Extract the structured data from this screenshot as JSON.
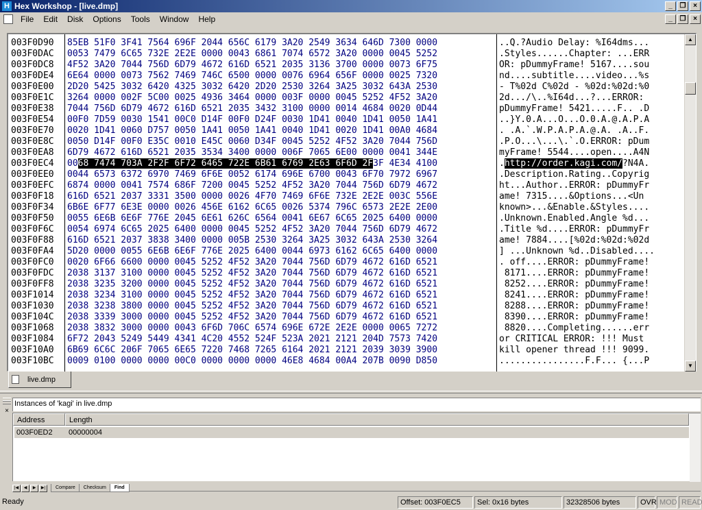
{
  "window": {
    "title": "Hex Workshop - [live.dmp]",
    "app_icon": "H"
  },
  "menu": [
    "File",
    "Edit",
    "Disk",
    "Options",
    "Tools",
    "Window",
    "Help"
  ],
  "hex_rows": [
    {
      "addr": "003F0D90",
      "hex": "85EB 51F0 3F41 7564 696F 2044 656C 6179 3A20 2549 3634 646D 7300 0000",
      "ascii": "..Q.?Audio Delay: %I64dms..."
    },
    {
      "addr": "003F0DAC",
      "hex": "0053 7479 6C65 732E 2E2E 0000 0043 6861 7074 6572 3A20 0000 0045 5252",
      "ascii": ".Styles......Chapter: ...ERR"
    },
    {
      "addr": "003F0DC8",
      "hex": "4F52 3A20 7044 756D 6D79 4672 616D 6521 2035 3136 3700 0000 0073 6F75",
      "ascii": "OR: pDummyFrame! 5167....sou"
    },
    {
      "addr": "003F0DE4",
      "hex": "6E64 0000 0073 7562 7469 746C 6500 0000 0076 6964 656F 0000 0025 7320",
      "ascii": "nd....subtitle....video...%s "
    },
    {
      "addr": "003F0E00",
      "hex": "2D20 5425 3032 6420 4325 3032 6420 2D20 2530 3264 3A25 3032 643A 2530",
      "ascii": "- T%02d C%02d - %02d:%02d:%0"
    },
    {
      "addr": "003F0E1C",
      "hex": "3264 0000 002F 5C00 0025 4936 3464 0000 003F 0000 0045 5252 4F52 3A20",
      "ascii": "2d.../\\..%I64d...?...ERROR: "
    },
    {
      "addr": "003F0E38",
      "hex": "7044 756D 6D79 4672 616D 6521 2035 3432 3100 0000 0014 4684 0020 0D44",
      "ascii": "pDummyFrame! 5421.....F.. .D"
    },
    {
      "addr": "003F0E54",
      "hex": "00F0 7D59 0030 1541 00C0 D14F 00F0 D24F 0030 1D41 0040 1D41 0050 1A41",
      "ascii": "..}Y.0.A...O...O.0.A.@.A.P.A"
    },
    {
      "addr": "003F0E70",
      "hex": "0020 1D41 0060 D757 0050 1A41 0050 1A41 0040 1D41 0020 1D41 00A0 4684",
      "ascii": ". .A.`.W.P.A.P.A.@.A. .A..F."
    },
    {
      "addr": "003F0E8C",
      "hex": "0050 D14F 00F0 E35C 0010 E45C 0060 D34F 0045 5252 4F52 3A20 7044 756D",
      "ascii": ".P.O...\\...\\.`.O.ERROR: pDum"
    },
    {
      "addr": "003F0EA8",
      "hex": "6D79 4672 616D 6521 2035 3534 3400 0000 006F 7065 6E00 0000 0041 344E",
      "ascii": "myFrame! 5544....open....A4N"
    },
    {
      "addr": "003F0EC4",
      "hex_pre": "00",
      "hex_hl": "68 7474 703A 2F2F 6F72 6465 722E 6B61 6769 2E63 6F6D 2F",
      "hex_post": "3F 4E34 4100",
      "ascii_pre": ".",
      "ascii_hl": "http://order.kagi.com/",
      "ascii_post": "?N4A."
    },
    {
      "addr": "003F0EE0",
      "hex": "0044 6573 6372 6970 7469 6F6E 0052 6174 696E 6700 0043 6F70 7972 6967",
      "ascii": ".Description.Rating..Copyrig"
    },
    {
      "addr": "003F0EFC",
      "hex": "6874 0000 0041 7574 686F 7200 0045 5252 4F52 3A20 7044 756D 6D79 4672",
      "ascii": "ht...Author..ERROR: pDummyFr"
    },
    {
      "addr": "003F0F18",
      "hex": "616D 6521 2037 3331 3500 0000 0026 4F70 7469 6F6E 732E 2E2E 003C 556E",
      "ascii": "ame! 7315....&Options...<Un"
    },
    {
      "addr": "003F0F34",
      "hex": "6B6E 6F77 6E3E 0000 0026 456E 6162 6C65 0026 5374 796C 6573 2E2E 2E00",
      "ascii": "known>...&Enable.&Styles...."
    },
    {
      "addr": "003F0F50",
      "hex": "0055 6E6B 6E6F 776E 2045 6E61 626C 6564 0041 6E67 6C65 2025 6400 0000",
      "ascii": ".Unknown.Enabled.Angle %d..."
    },
    {
      "addr": "003F0F6C",
      "hex": "0054 6974 6C65 2025 6400 0000 0045 5252 4F52 3A20 7044 756D 6D79 4672",
      "ascii": ".Title %d....ERROR: pDummyFr"
    },
    {
      "addr": "003F0F88",
      "hex": "616D 6521 2037 3838 3400 0000 005B 2530 3264 3A25 3032 643A 2530 3264",
      "ascii": "ame! 7884....[%02d:%02d:%02d"
    },
    {
      "addr": "003F0FA4",
      "hex": "5D20 0000 0055 6E6B 6E6F 776E 2025 6400 0044 6973 6162 6C65 6400 0000",
      "ascii": "] ...Unknown %d..Disabled...."
    },
    {
      "addr": "003F0FC0",
      "hex": "0020 6F66 6600 0000 0045 5252 4F52 3A20 7044 756D 6D79 4672 616D 6521",
      "ascii": ". off....ERROR: pDummyFrame!"
    },
    {
      "addr": "003F0FDC",
      "hex": "2038 3137 3100 0000 0045 5252 4F52 3A20 7044 756D 6D79 4672 616D 6521",
      "ascii": " 8171....ERROR: pDummyFrame!"
    },
    {
      "addr": "003F0FF8",
      "hex": "2038 3235 3200 0000 0045 5252 4F52 3A20 7044 756D 6D79 4672 616D 6521",
      "ascii": " 8252....ERROR: pDummyFrame!"
    },
    {
      "addr": "003F1014",
      "hex": "2038 3234 3100 0000 0045 5252 4F52 3A20 7044 756D 6D79 4672 616D 6521",
      "ascii": " 8241....ERROR: pDummyFrame!"
    },
    {
      "addr": "003F1030",
      "hex": "2038 3238 3800 0000 0045 5252 4F52 3A20 7044 756D 6D79 4672 616D 6521",
      "ascii": " 8288....ERROR: pDummyFrame!"
    },
    {
      "addr": "003F104C",
      "hex": "2038 3339 3000 0000 0045 5252 4F52 3A20 7044 756D 6D79 4672 616D 6521",
      "ascii": " 8390....ERROR: pDummyFrame!"
    },
    {
      "addr": "003F1068",
      "hex": "2038 3832 3000 0000 0043 6F6D 706C 6574 696E 672E 2E2E 0000 0065 7272",
      "ascii": " 8820....Completing......err"
    },
    {
      "addr": "003F1084",
      "hex": "6F72 2043 5249 5449 4341 4C20 4552 524F 523A 2021 2121 204D 7573 7420",
      "ascii": "or CRITICAL ERROR: !!! Must "
    },
    {
      "addr": "003F10A0",
      "hex": "6B69 6C6C 206F 7065 6E65 7220 7468 7265 6164 2021 2121 2039 3039 3900",
      "ascii": "kill opener thread !!! 9099."
    },
    {
      "addr": "003F10BC",
      "hex": "0009 0100 0000 0000 00C0 0000 0000 0000 46E8 4684 00A4 207B 0090 D850",
      "ascii": "................F.F... {...P"
    }
  ],
  "doc_tab": {
    "label": "live.dmp"
  },
  "results": {
    "title": "Instances of 'kagi' in live.dmp",
    "columns": [
      "Address",
      "Length"
    ],
    "rows": [
      {
        "address": "003F0ED2",
        "length": "00000004"
      }
    ]
  },
  "bottom_tabs": [
    "Compare",
    "Checksum",
    "Find"
  ],
  "status": {
    "ready": "Ready",
    "offset": "Offset: 003F0EC5",
    "sel": "Sel: 0x16 bytes",
    "size": "32328506 bytes",
    "ovr": "OVR",
    "mod": "MOD",
    "read": "READ"
  }
}
